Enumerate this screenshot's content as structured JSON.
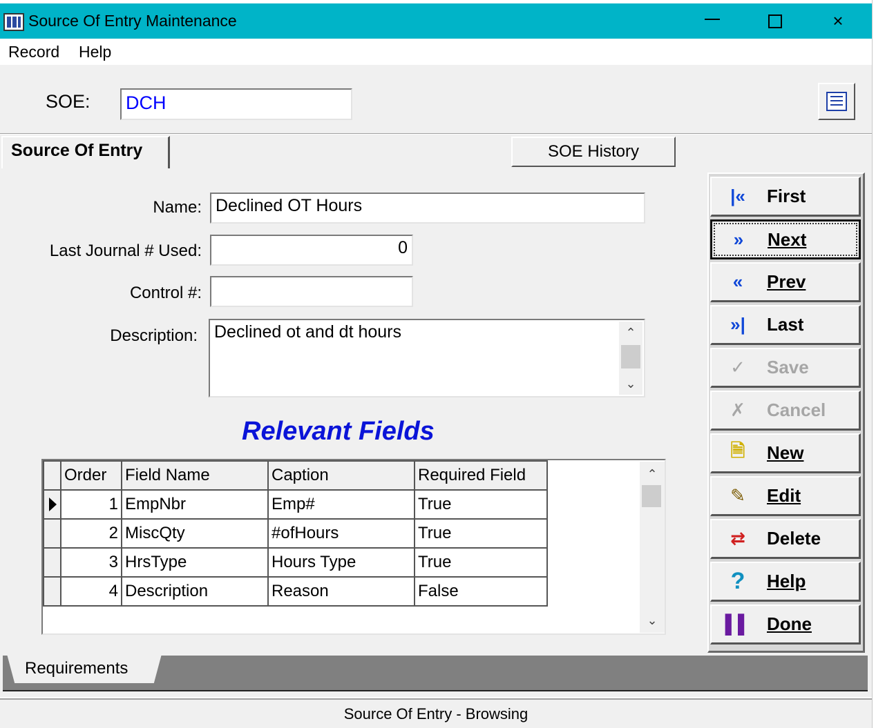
{
  "window": {
    "title": "Source Of Entry Maintenance",
    "titlebar_color": "#00b4c8",
    "controls": {
      "minimize": "minimize-icon",
      "maximize": "maximize-icon",
      "close": "×"
    }
  },
  "menu": [
    {
      "label": "Record"
    },
    {
      "label": "Help"
    }
  ],
  "soe": {
    "label": "SOE:",
    "value": "DCH",
    "value_color": "#0000ff"
  },
  "tabs": [
    {
      "label": "Source Of Entry",
      "active": true
    },
    {
      "label": "SOE History",
      "active": false
    }
  ],
  "form": {
    "name": {
      "label": "Name:",
      "value": "Declined OT Hours"
    },
    "last_journal": {
      "label": "Last Journal # Used:",
      "value": "0"
    },
    "control": {
      "label": "Control #:",
      "value": ""
    },
    "description": {
      "label": "Description:",
      "value": "Declined ot and dt hours"
    }
  },
  "relevant_fields": {
    "title": "Relevant Fields",
    "title_color": "#0a14d8",
    "columns": [
      "Order",
      "Field Name",
      "Caption",
      "Required Field"
    ],
    "rows": [
      {
        "order": "1",
        "field_name": "EmpNbr",
        "caption": "Emp#",
        "required": "True",
        "current": true
      },
      {
        "order": "2",
        "field_name": "MiscQty",
        "caption": "#ofHours",
        "required": "True",
        "current": false
      },
      {
        "order": "3",
        "field_name": "HrsType",
        "caption": "Hours Type",
        "required": "True",
        "current": false
      },
      {
        "order": "4",
        "field_name": "Description",
        "caption": "Reason",
        "required": "False",
        "current": false
      }
    ]
  },
  "nav_buttons": [
    {
      "label": "First",
      "icon": "first-icon",
      "enabled": true
    },
    {
      "label": "Next",
      "icon": "next-icon",
      "enabled": true,
      "focused": true
    },
    {
      "label": "Prev",
      "icon": "prev-icon",
      "enabled": true
    },
    {
      "label": "Last",
      "icon": "last-icon",
      "enabled": true
    },
    {
      "label": "Save",
      "icon": "save-icon",
      "enabled": false
    },
    {
      "label": "Cancel",
      "icon": "cancel-icon",
      "enabled": false
    },
    {
      "label": "New",
      "icon": "new-icon",
      "enabled": true
    },
    {
      "label": "Edit",
      "icon": "edit-icon",
      "enabled": true
    },
    {
      "label": "Delete",
      "icon": "delete-icon",
      "enabled": true
    },
    {
      "label": "Help",
      "icon": "help-icon",
      "enabled": true
    },
    {
      "label": "Done",
      "icon": "done-icon",
      "enabled": true
    }
  ],
  "bottom_tabs": [
    {
      "label": "Requirements"
    }
  ],
  "status": {
    "text": "Source Of Entry - Browsing"
  }
}
